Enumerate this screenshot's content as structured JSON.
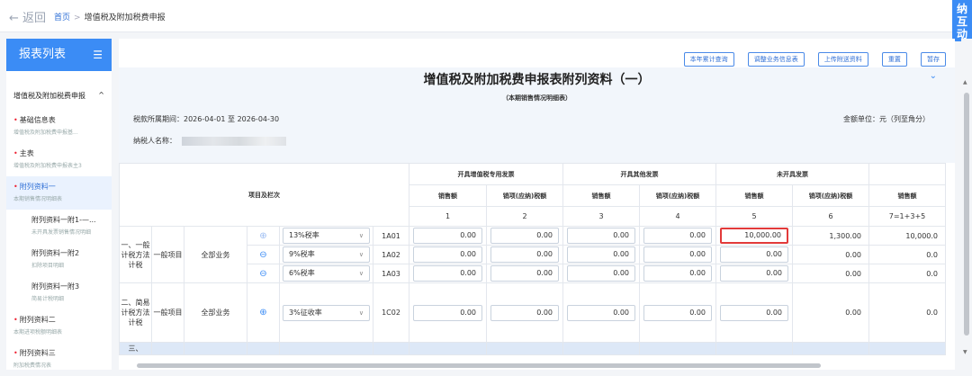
{
  "topbar": {
    "back_label": "← 返回",
    "crumb_home": "首页",
    "crumb_sep": ">",
    "crumb_current": "增值税及附加税费申报"
  },
  "side_tab": {
    "label": "纳互动"
  },
  "sidebar": {
    "title": "报表列表",
    "group": "增值税及附加税费申报",
    "items": [
      {
        "label": "基础信息表",
        "sub": "增值税及附加税费申报基...",
        "star": "•"
      },
      {
        "label": "主表",
        "sub": "增值税及附加税费申报表主3",
        "star": "•"
      },
      {
        "label": "附列资料一",
        "sub": "本期销售情况明细表",
        "star": "•"
      },
      {
        "label": "附列资料一附1-—...",
        "sub": "未开具发票销售情况明细",
        "star": ""
      },
      {
        "label": "附列资料一附2",
        "sub": "扣除项目明细",
        "star": ""
      },
      {
        "label": "附列资料一附3",
        "sub": "简易计税明细",
        "star": ""
      },
      {
        "label": "附列资料二",
        "sub": "本期进项税额明细表",
        "star": "•"
      },
      {
        "label": "附列资料三",
        "sub": "附加税费情况表",
        "star": "•"
      }
    ]
  },
  "toolbar": {
    "btn1": "本年累计查询",
    "btn2": "调整业务信息表",
    "btn3": "上传附送资料",
    "btn4": "重置",
    "btn5": "暂存"
  },
  "form": {
    "title": "增值税及附加税费申报表附列资料（一）",
    "subtitle": "（本期销售情况明细表）",
    "period": "税款所属期间：2026-04-01 至 2026-04-30",
    "unit": "金额单位：元（列至角分）",
    "taxpayer_label": "纳税人名称：",
    "colors": {
      "accent": "#3b8cf5",
      "highlight": "#e23a3a"
    }
  },
  "table": {
    "items_header": "项目及栏次",
    "groups": [
      "开具增值税专用发票",
      "开具其他发票",
      "未开具发票"
    ],
    "sub_headers": [
      "销售额",
      "销项(应纳)税额",
      "销售额",
      "销项(应纳)税额",
      "销售额",
      "销项(应纳)税额",
      "销售额"
    ],
    "col_nums": [
      "1",
      "2",
      "3",
      "4",
      "5",
      "6",
      "7=1+3+5"
    ],
    "sec1": {
      "label": "一、一般计税方法计税",
      "category": "一般项目",
      "business": "全部业务"
    },
    "sec2": {
      "label": "二、简易计税方法计税",
      "category": "一般项目",
      "business": "全部业务"
    },
    "sec3_partial": "三、",
    "rows": [
      {
        "rate": "13%税率",
        "code": "1A01",
        "op": "add",
        "v": [
          "0.00",
          "0.00",
          "0.00",
          "0.00",
          "10,000.00",
          "1,300.00",
          "10,000.0"
        ]
      },
      {
        "rate": "9%税率",
        "code": "1A02",
        "op": "remove",
        "v": [
          "0.00",
          "0.00",
          "0.00",
          "0.00",
          "0.00",
          "0.00",
          "0.0"
        ]
      },
      {
        "rate": "6%税率",
        "code": "1A03",
        "op": "remove",
        "v": [
          "0.00",
          "0.00",
          "0.00",
          "0.00",
          "0.00",
          "0.00",
          "0.0"
        ]
      },
      {
        "rate": "3%征收率",
        "code": "1C02",
        "op": "add",
        "v": [
          "0.00",
          "0.00",
          "0.00",
          "0.00",
          "0.00",
          "0.00",
          "0.0"
        ]
      }
    ]
  }
}
